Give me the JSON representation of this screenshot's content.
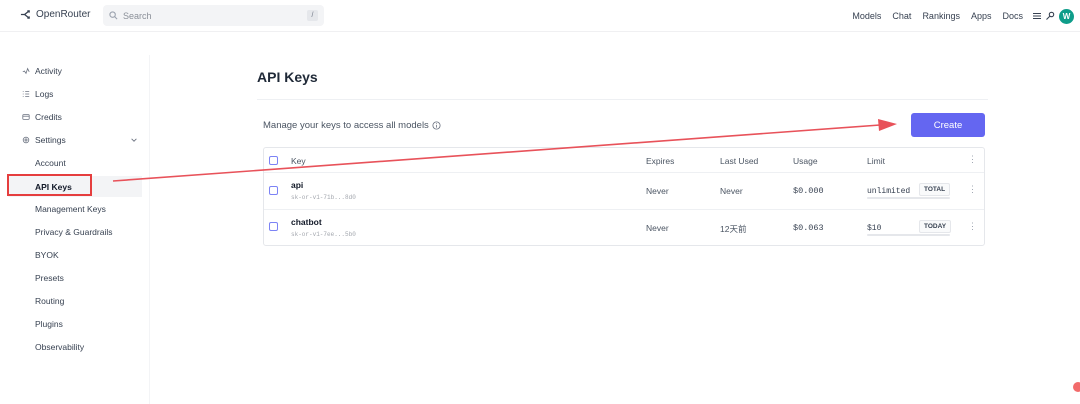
{
  "brand": {
    "name": "OpenRouter",
    "icon": "openrouter-logo-icon"
  },
  "search": {
    "placeholder": "Search",
    "shortcut": "/"
  },
  "nav": {
    "models": "Models",
    "chat": "Chat",
    "rankings": "Rankings",
    "apps": "Apps",
    "docs": "Docs",
    "avatar": "W"
  },
  "sidebar": {
    "activity": "Activity",
    "logs": "Logs",
    "credits": "Credits",
    "settings": "Settings",
    "account": "Account",
    "api_keys": "API Keys",
    "management_keys": "Management Keys",
    "privacy": "Privacy & Guardrails",
    "byok": "BYOK",
    "presets": "Presets",
    "routing": "Routing",
    "plugins": "Plugins",
    "observability": "Observability"
  },
  "page": {
    "title": "API Keys",
    "subtitle": "Manage your keys to access all models",
    "create_label": "Create"
  },
  "table": {
    "headers": {
      "key": "Key",
      "expires": "Expires",
      "last_used": "Last Used",
      "usage": "Usage",
      "limit": "Limit"
    },
    "rows": [
      {
        "name": "api",
        "mask": "sk-or-v1-71b...8d0",
        "expires": "Never",
        "last_used": "Never",
        "usage": "$0.000",
        "limit": "unlimited",
        "badge": "TOTAL"
      },
      {
        "name": "chatbot",
        "mask": "sk-or-v1-7ee...5b0",
        "expires": "Never",
        "last_used": "12天前",
        "usage": "$0.063",
        "limit": "$10",
        "badge": "TODAY"
      }
    ]
  },
  "colors": {
    "accent": "#6466f1",
    "annotation": "#e53e3e",
    "avatar": "#0f9d8a"
  }
}
